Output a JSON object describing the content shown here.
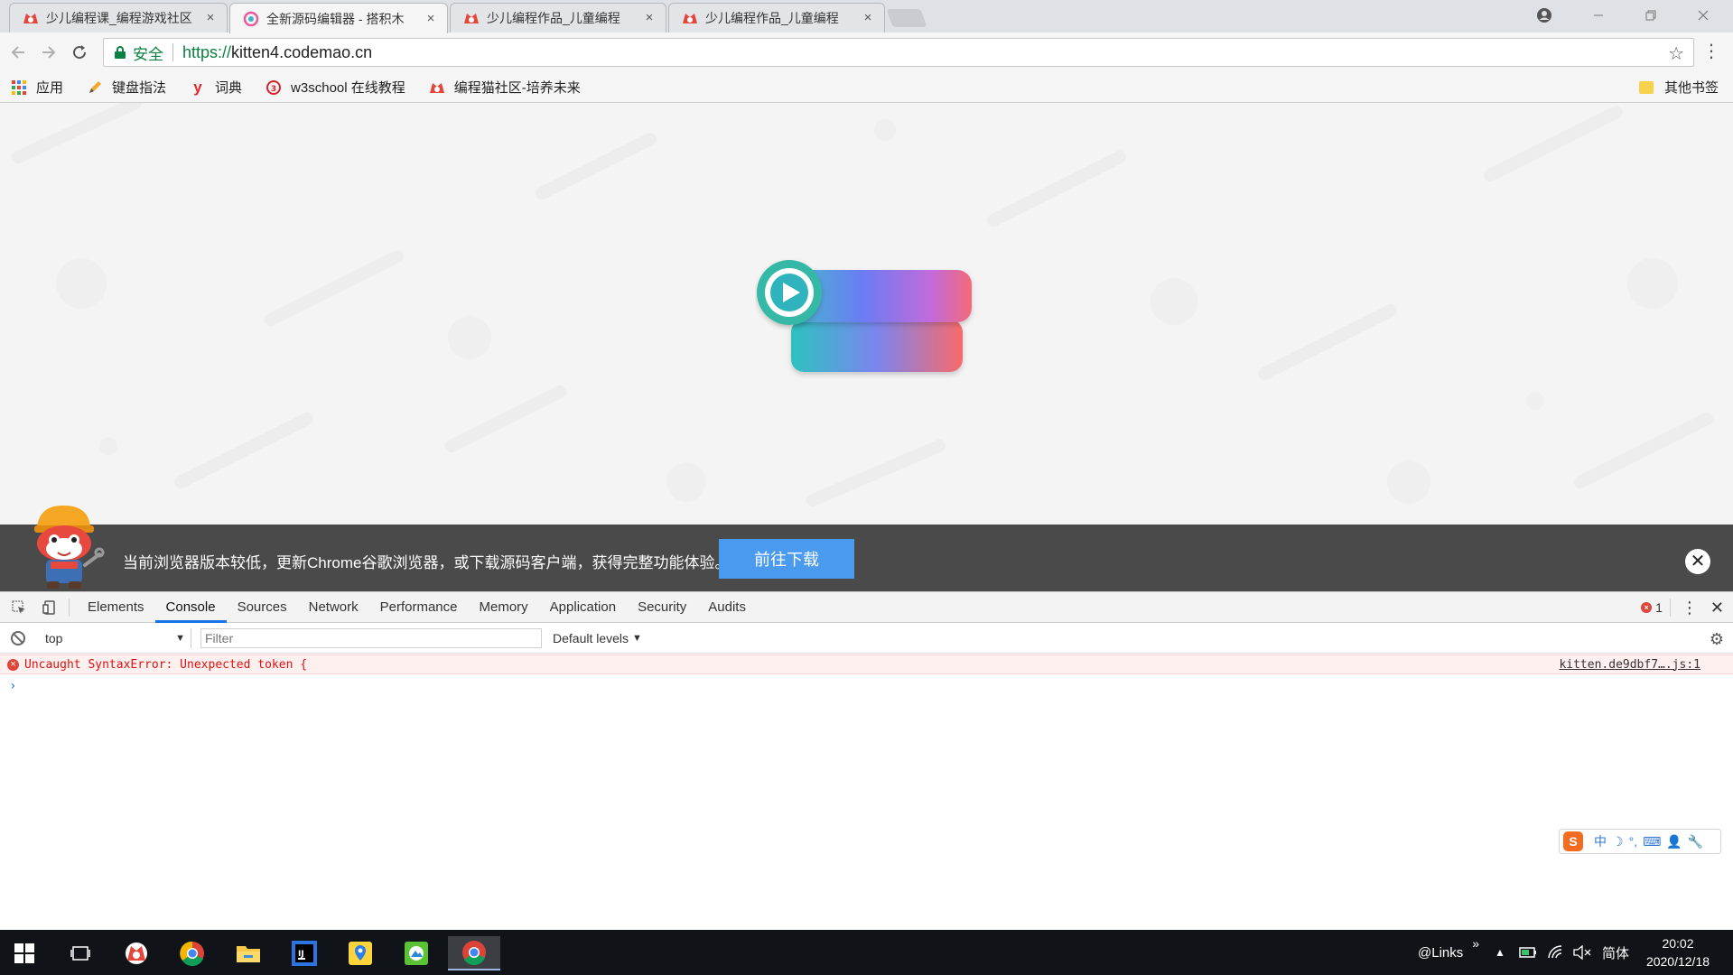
{
  "browser": {
    "tabs": [
      {
        "label": "少儿编程课_编程游戏社区",
        "active": false
      },
      {
        "label": "全新源码编辑器 - 搭积木",
        "active": true
      },
      {
        "label": "少儿编程作品_儿童编程",
        "active": false
      },
      {
        "label": "少儿编程作品_儿童编程",
        "active": false
      }
    ],
    "tab_close_glyph": "×",
    "secure_label": "安全",
    "url_scheme": "https://",
    "url_host": "kitten4.codemao.cn",
    "bookmarks": [
      {
        "label": "应用",
        "icon": "apps-grid-icon"
      },
      {
        "label": "键盘指法",
        "icon": "pencil-icon"
      },
      {
        "label": "词典",
        "icon": "youdao-icon"
      },
      {
        "label": "w3school 在线教程",
        "icon": "w3school-icon"
      },
      {
        "label": "编程猫社区-培养未来",
        "icon": "codemao-icon"
      }
    ],
    "other_bookmarks": "其他书签"
  },
  "banner": {
    "message": "当前浏览器版本较低，更新Chrome谷歌浏览器，或下载源码客户端，获得完整功能体验。",
    "download_button": "前往下载",
    "close_glyph": "✕"
  },
  "devtools": {
    "tabs": [
      "Elements",
      "Console",
      "Sources",
      "Network",
      "Performance",
      "Memory",
      "Application",
      "Security",
      "Audits"
    ],
    "active_tab": "Console",
    "error_count": "1",
    "context": "top",
    "filter_placeholder": "Filter",
    "levels": "Default levels",
    "messages": [
      {
        "level": "error",
        "text": "Uncaught SyntaxError: Unexpected token {",
        "source": "kitten.de9dbf7….js:1"
      }
    ],
    "prompt": "›"
  },
  "ime": {
    "items": [
      "中",
      "☽",
      "°,",
      "⌨",
      "👤",
      "🔧"
    ]
  },
  "taskbar": {
    "apps": [
      "start-icon",
      "task-view-icon",
      "codemao-app-icon",
      "chrome-icon",
      "file-explorer-icon",
      "intellij-icon",
      "maps-icon",
      "photos-icon",
      "chrome-active-icon"
    ],
    "links_label": "@Links",
    "chevron": "»",
    "ime_mode": "简体",
    "time": "20:02",
    "date": "2020/12/18"
  },
  "colors": {
    "secure_green": "#0b8043",
    "banner_bg": "#4a4a4a",
    "download_blue": "#4a9af0",
    "error_red": "#d11111",
    "devtools_active": "#1a73e8"
  }
}
